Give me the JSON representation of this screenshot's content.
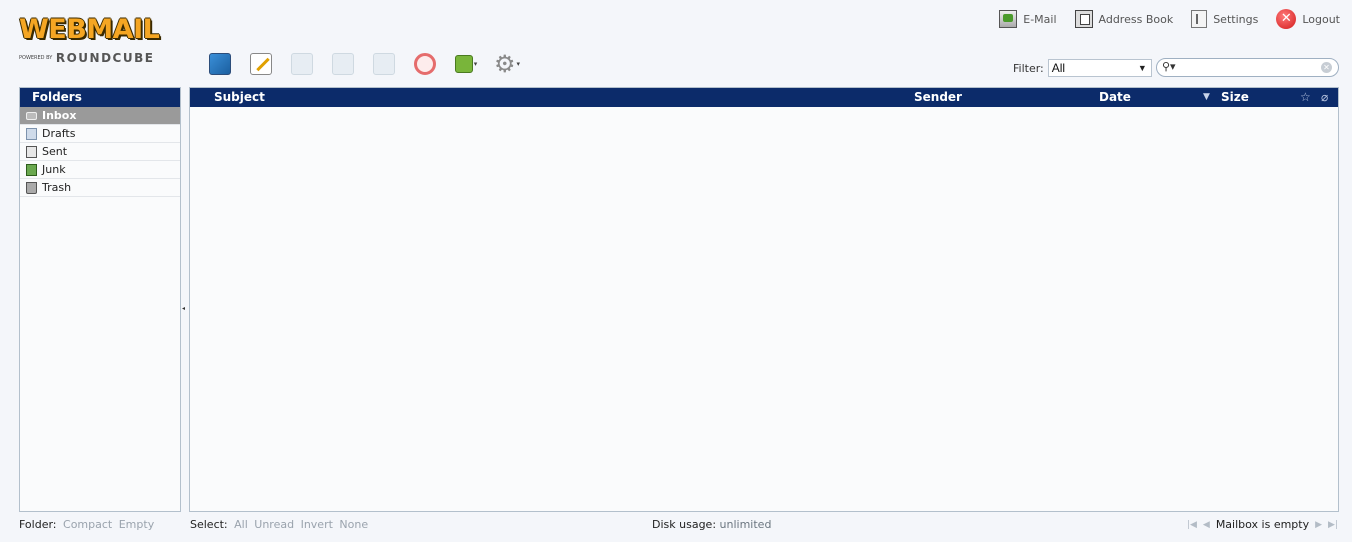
{
  "logo": {
    "title": "WEBMAIL",
    "powered": "POWERED BY",
    "brand": "ROUNDCUBE"
  },
  "topnav": {
    "email": "E-Mail",
    "addressbook": "Address Book",
    "settings": "Settings",
    "logout": "Logout"
  },
  "filter": {
    "label": "Filter:",
    "value": "All"
  },
  "search": {
    "placeholder": ""
  },
  "folders": {
    "header": "Folders",
    "items": [
      {
        "label": "Inbox",
        "active": true
      },
      {
        "label": "Drafts"
      },
      {
        "label": "Sent"
      },
      {
        "label": "Junk"
      },
      {
        "label": "Trash"
      }
    ]
  },
  "list": {
    "subject": "Subject",
    "sender": "Sender",
    "date": "Date",
    "size": "Size"
  },
  "footer": {
    "folder_label": "Folder:",
    "compact": "Compact",
    "empty": "Empty",
    "select_label": "Select:",
    "all": "All",
    "unread": "Unread",
    "invert": "Invert",
    "none": "None",
    "quota_label": "Disk usage:",
    "quota_value": "unlimited",
    "count": "Mailbox is empty"
  },
  "colors": {
    "header_bg": "#0c2b6a",
    "active_folder": "#9a9a9a",
    "logo": "#f5a623"
  }
}
